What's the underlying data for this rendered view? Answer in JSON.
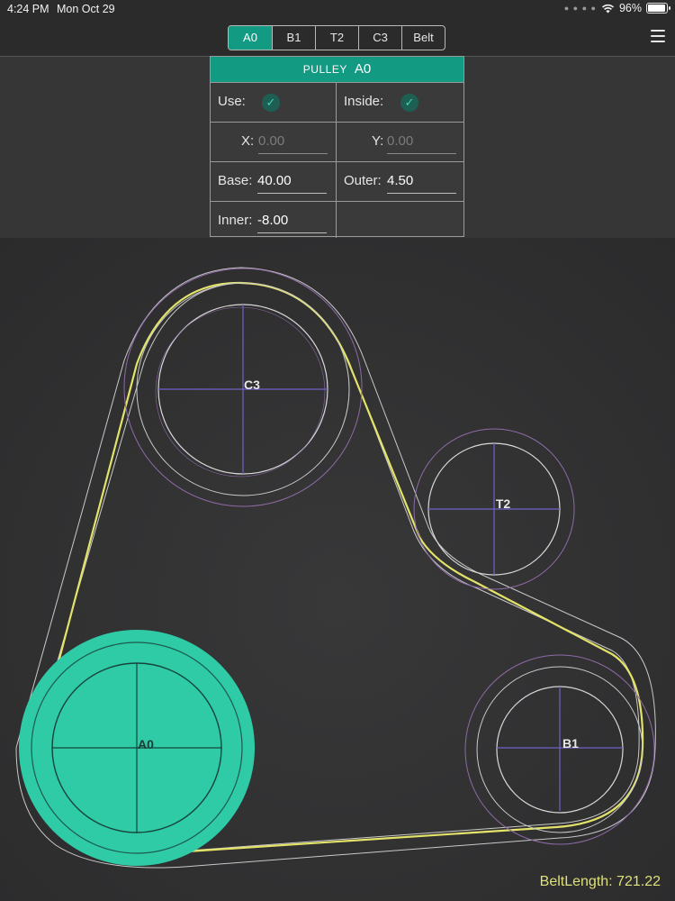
{
  "status": {
    "time": "4:24 PM",
    "date": "Mon Oct 29",
    "battery": "96%"
  },
  "tabs": [
    {
      "label": "A0",
      "active": true
    },
    {
      "label": "B1",
      "active": false
    },
    {
      "label": "T2",
      "active": false
    },
    {
      "label": "C3",
      "active": false
    },
    {
      "label": "Belt",
      "active": false
    }
  ],
  "panel": {
    "header_prefix": "PULLEY",
    "header_name": "A0",
    "use_label": "Use:",
    "inside_label": "Inside:",
    "x_label": "X:",
    "x_value": "0.00",
    "y_label": "Y:",
    "y_value": "0.00",
    "base_label": "Base:",
    "base_value": "40.00",
    "outer_label": "Outer:",
    "outer_value": "4.50",
    "inner_label": "Inner:",
    "inner_value": "-8.00"
  },
  "pulleys": {
    "c3": "C3",
    "t2": "T2",
    "a0": "A0",
    "b1": "B1"
  },
  "belt_length": "BeltLength: 721.22",
  "colors": {
    "accent": "#129a83",
    "selected_pulley": "#2fcaa6",
    "belt": "#e3e36a",
    "outline": "#c9c9c9",
    "crosshair": "#6e63c9",
    "outer_ring": "#8d6aa6"
  }
}
